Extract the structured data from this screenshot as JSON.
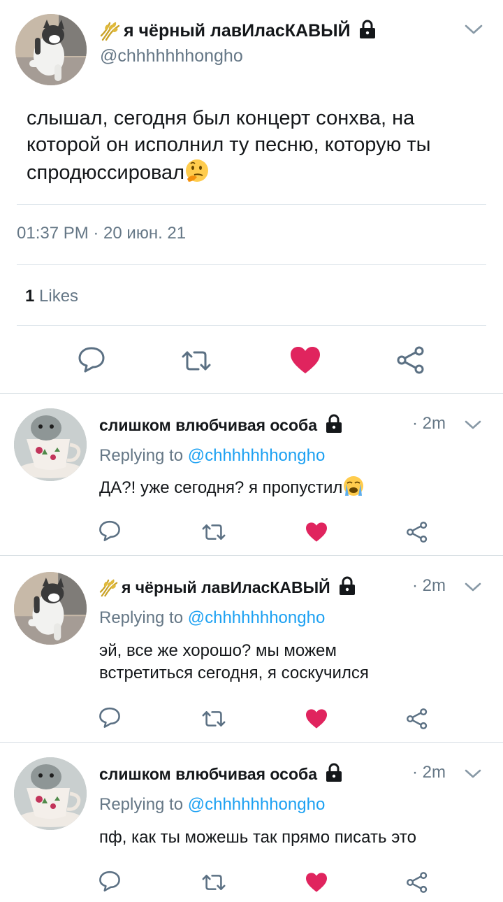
{
  "main_tweet": {
    "author_name": "я чёрный лавИласКАВЫЙ",
    "author_handle": "@chhhhhhhongho",
    "text": "слышал, сегодня был концерт сонхва, на которой он исполнил ту песню, которую ты спродюссировал",
    "timestamp": "01:37 PM · 20 июн. 21",
    "likes_count": "1",
    "likes_label": "Likes"
  },
  "replies": [
    {
      "author_name": "слишком влюбчивая особа",
      "time": "· 2m",
      "replying_prefix": "Replying to",
      "replying_to": "@chhhhhhhongho",
      "text": "ДА?! уже сегодня? я пропустил"
    },
    {
      "author_name": "я чёрный лавИласКАВЫЙ",
      "time": "· 2m",
      "replying_prefix": "Replying to",
      "replying_to": "@chhhhhhhongho",
      "text": "эй, все же хорошо? мы можем встретиться сегодня, я соскучился"
    },
    {
      "author_name": "слишком влюбчивая особа",
      "time": "· 2m",
      "replying_prefix": "Replying to",
      "replying_to": "@chhhhhhhongho",
      "text": "пф, как ты можешь так прямо писать это"
    }
  ],
  "icons": {
    "reply": "comment-bubble-icon",
    "retweet": "retweet-icon",
    "like": "heart-icon",
    "share": "share-icon",
    "lock": "lock-icon",
    "menu": "chevron-down-icon"
  },
  "colors": {
    "like_red": "#e0245e",
    "mention_blue": "#1da1f2",
    "muted_gray": "#657786",
    "icon_gray": "#5b7083"
  }
}
